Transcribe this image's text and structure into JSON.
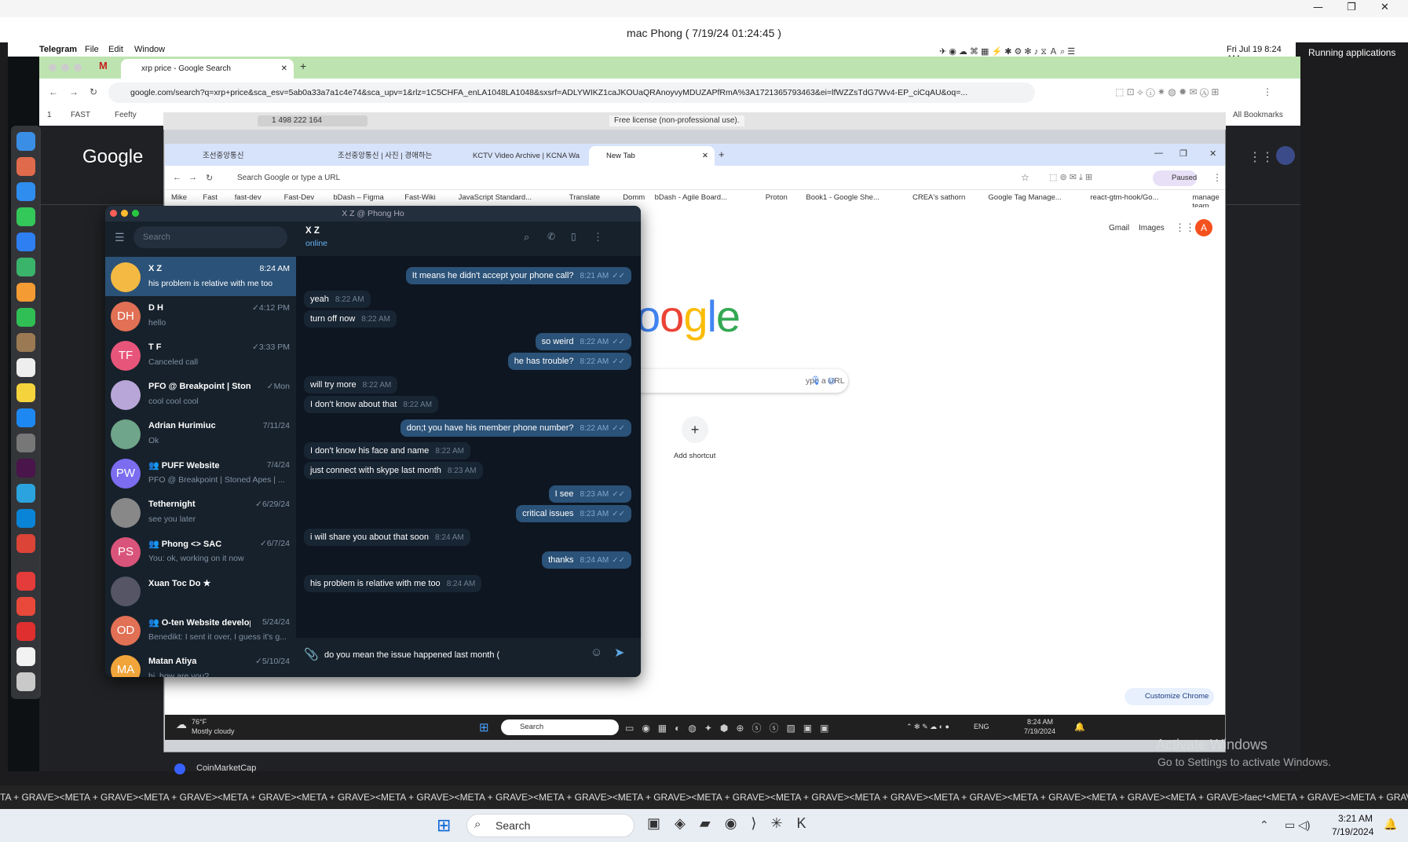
{
  "remote": {
    "header": "mac Phong    ( 7/19/24 01:24:45 )"
  },
  "mac": {
    "menubar": {
      "app": "Telegram",
      "file": "File",
      "edit": "Edit",
      "window": "Window",
      "clock": "Fri Jul 19  8:24 AM"
    },
    "running_apps": "Running applications"
  },
  "chrome1": {
    "tab_title": "xrp price - Google Search",
    "address": "google.com/search?q=xrp+price&sca_esv=5ab0a33a7a1c4e74&sca_upv=1&rlz=1C5CHFA_enLA1048LA1048&sxsrf=ADLYWIKZ1caJKOUaQRAnoyvyMDUZAPfRmA%3A1721365793463&ei=lfWZZsTdG7Wv4-EP_ciCqAU&oq=...",
    "bookmarks": [
      "1",
      "FAST",
      "Feefty"
    ],
    "all_bookmarks": "All Bookmarks",
    "google_logo": "Google",
    "coinmarketcap": "CoinMarketCap"
  },
  "vm": {
    "topbar_number": "1 498 222 164",
    "license": "Free license (non-professional use)."
  },
  "chrome2": {
    "tabs": [
      "조선중앙통신",
      "조선중앙통신 | 사진 | 경애하는",
      "KCTV Video Archive | KCNA Wa",
      "New Tab"
    ],
    "address_placeholder": "Search Google or type a URL",
    "paused": "Paused",
    "bookmarks": [
      "Mike",
      "Fast",
      "fast-dev",
      "Fast-Dev",
      "bDash – Figma",
      "Fast-Wiki",
      "JavaScript Standard...",
      "Translate",
      "Domm",
      "bDash - Agile Board...",
      "Proton",
      "Book1 - Google She...",
      "CREA's sathorn",
      "Google Tag Manage...",
      "react-gtm-hook/Go...",
      "manage team"
    ],
    "gmail": "Gmail",
    "images": "Images",
    "avatar": "A",
    "logo_visible": "oogle",
    "search_placeholder": "ype a URL",
    "add_shortcut": "Add shortcut",
    "customize": "Customize Chrome"
  },
  "win_taskbar": {
    "weather_temp": "76°F",
    "weather_desc": "Mostly cloudy",
    "search": "Search",
    "lang": "ENG",
    "time": "8:24 AM",
    "date": "7/19/2024"
  },
  "telegram": {
    "window_title": "X Z @ Phong Ho",
    "search_placeholder": "Search",
    "chats": [
      {
        "initials": "",
        "name": "X Z",
        "preview": "his problem is relative with me too",
        "time": "8:24 AM",
        "color": "#f4b942"
      },
      {
        "initials": "DH",
        "name": "D H",
        "preview": "hello",
        "time": "✓4:12 PM",
        "color": "#e17055"
      },
      {
        "initials": "TF",
        "name": "T F",
        "preview": "Canceled call",
        "time": "✓3:33 PM",
        "color": "#e8557a"
      },
      {
        "initials": "",
        "name": "PFO @ Breakpoint | Stone...",
        "preview": "cool cool cool",
        "time": "✓Mon",
        "color": "#b9a6d9"
      },
      {
        "initials": "",
        "name": "Adrian Hurimiuc",
        "preview": "Ok",
        "time": "7/11/24",
        "color": "#6fa58a"
      },
      {
        "initials": "PW",
        "name": "👥 PUFF Website",
        "preview": "PFO @ Breakpoint | Stoned Apes | ...",
        "time": "7/4/24",
        "color": "#7c6cf0"
      },
      {
        "initials": "",
        "name": "Tethernight",
        "preview": "see you later",
        "time": "✓6/29/24",
        "color": "#888"
      },
      {
        "initials": "PS",
        "name": "👥 Phong <> SAC",
        "preview": "You: ok, working on it now",
        "time": "✓6/7/24",
        "color": "#d9547a"
      },
      {
        "initials": "",
        "name": "Xuan Toc Do ★",
        "preview": "",
        "time": "",
        "color": "#556"
      },
      {
        "initials": "OD",
        "name": "👥 O-ten Website develop...",
        "preview": "Benedikt: I sent it over, I guess it's g...",
        "time": "5/24/24",
        "color": "#e17055"
      },
      {
        "initials": "MA",
        "name": "Matan Atiya",
        "preview": "hi, how are you?",
        "time": "✓5/10/24",
        "color": "#f0a43a"
      }
    ],
    "header": {
      "name": "X Z",
      "status": "online"
    },
    "messages": [
      {
        "dir": "out",
        "text": "It means he didn't accept your phone call?",
        "time": "8:21 AM"
      },
      {
        "dir": "in",
        "text": "yeah",
        "time": "8:22 AM"
      },
      {
        "dir": "in",
        "text": "turn off now",
        "time": "8:22 AM"
      },
      {
        "dir": "out",
        "text": "so weird",
        "time": "8:22 AM"
      },
      {
        "dir": "out",
        "text": "he has trouble?",
        "time": "8:22 AM"
      },
      {
        "dir": "in",
        "text": "will try more",
        "time": "8:22 AM"
      },
      {
        "dir": "in",
        "text": "I don't know about that",
        "time": "8:22 AM"
      },
      {
        "dir": "out",
        "text": "don;t you have his member phone number?",
        "time": "8:22 AM"
      },
      {
        "dir": "in",
        "text": "I don't know his face and name",
        "time": "8:22 AM"
      },
      {
        "dir": "in",
        "text": "just connect with skype last month",
        "time": "8:23 AM"
      },
      {
        "dir": "out",
        "text": "I see",
        "time": "8:23 AM"
      },
      {
        "dir": "out",
        "text": "critical issues",
        "time": "8:23 AM"
      },
      {
        "dir": "in",
        "text": "i will share you about that soon",
        "time": "8:24 AM"
      },
      {
        "dir": "out",
        "text": "thanks",
        "time": "8:24 AM"
      },
      {
        "dir": "in",
        "text": "his problem is relative with me too",
        "time": "8:24 AM"
      }
    ],
    "composer_value": "do you mean the issue happened last month ("
  },
  "activate": {
    "title": "Activate Windows",
    "sub": "Go to Settings to activate Windows."
  },
  "meta_line": "TA + GRAVE><META + GRAVE><META + GRAVE><META + GRAVE><META + GRAVE><META + GRAVE><META + GRAVE><META + GRAVE><META + GRAVE><META + GRAVE><META + GRAVE><META + GRAVE><META + GRAVE><META + GRAVE><META + GRAVE><META + GRAVE>faec⁴<META + GRAVE><META + GRAVE><META + GRAVE><META + GRAVE><META + (",
  "host_taskbar": {
    "search": "Search",
    "time": "3:21 AM",
    "date": "7/19/2024"
  }
}
